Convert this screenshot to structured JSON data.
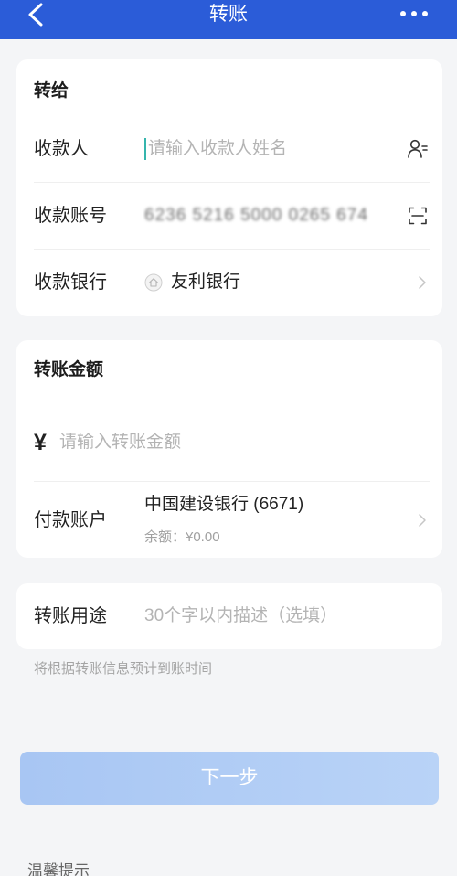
{
  "header": {
    "title": "转账",
    "back_icon": "chevron-left-icon",
    "more_icon": "more-dots-icon"
  },
  "payee": {
    "heading": "转给",
    "name_label": "收款人",
    "name_placeholder": "请输入收款人姓名",
    "name_icon": "contact-person-icon",
    "account_label": "收款账号",
    "account_value": "6236 5216 5000 0265 674",
    "account_icon": "scan-icon",
    "bank_label": "收款银行",
    "bank_icon": "bank-logo-icon",
    "bank_value": "友利银行"
  },
  "amount": {
    "heading": "转账金额",
    "currency_symbol": "¥",
    "placeholder": "请输入转账金额",
    "payer_label": "付款账户",
    "payer_account": "中国建设银行 (6671)",
    "payer_balance": "余额：¥0.00"
  },
  "purpose": {
    "label": "转账用途",
    "placeholder": "30个字以内描述（选填）"
  },
  "hint": "将根据转账信息预计到账时间",
  "next_button": "下一步",
  "tips_heading": "温馨提示",
  "colors": {
    "header_bg": "#2b5cd8",
    "button_bg": "#abc8f4",
    "cursor": "#35b5ad",
    "page_bg": "#f4f5f7"
  }
}
